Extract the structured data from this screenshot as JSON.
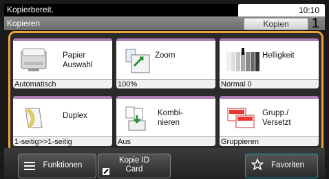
{
  "header": {
    "status": "Kopierbereit.",
    "time": "10:10",
    "screen_title": "Kopieren",
    "copies_label": "Kopien",
    "copies_count": "1"
  },
  "tiles": [
    {
      "label": "Papier\nAuswahl",
      "value": "Automatisch",
      "icon": "paper-tray-icon"
    },
    {
      "label": "Zoom",
      "value": "100%",
      "icon": "zoom-icon"
    },
    {
      "label": "Helligkeit",
      "value": "Normal 0",
      "icon": "brightness-icon"
    },
    {
      "label": "Duplex",
      "value": "1-seitig>>1-seitig",
      "icon": "duplex-icon"
    },
    {
      "label": "Kombi-\nnieren",
      "value": "Aus",
      "icon": "combine-icon"
    },
    {
      "label": "Grupp./\nVersetzt",
      "value": "Gruppieren",
      "icon": "collate-offset-icon"
    }
  ],
  "bottom": {
    "functions_label": "Funktionen",
    "idcard_label": "Kopie ID\nCard",
    "favorites_label": "Favoriten"
  }
}
